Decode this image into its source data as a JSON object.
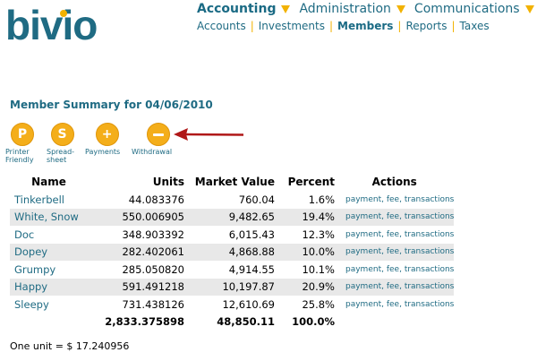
{
  "logo": {
    "text": "bivio",
    "color": "#1f6b83",
    "dot_color": "#f2b200"
  },
  "nav": {
    "top": [
      {
        "label": "Accounting",
        "active": true
      },
      {
        "label": "Administration",
        "active": false
      },
      {
        "label": "Communications",
        "active": false
      }
    ],
    "sub": [
      {
        "label": "Accounts",
        "active": false
      },
      {
        "label": "Investments",
        "active": false
      },
      {
        "label": "Members",
        "active": true
      },
      {
        "label": "Reports",
        "active": false
      },
      {
        "label": "Taxes",
        "active": false
      }
    ]
  },
  "page": {
    "title": "Member Summary for 04/06/2010"
  },
  "actions": [
    {
      "glyph": "P",
      "label_line1": "Printer",
      "label_line2": "Friendly"
    },
    {
      "glyph": "S",
      "label_line1": "Spread-",
      "label_line2": "sheet"
    },
    {
      "glyph": "+",
      "label_line1": "Payments",
      "label_line2": ""
    },
    {
      "glyph": "−",
      "label_line1": "Withdrawal",
      "label_line2": ""
    }
  ],
  "table": {
    "headers": {
      "name": "Name",
      "units": "Units",
      "market_value": "Market Value",
      "percent": "Percent",
      "actions": "Actions"
    },
    "rows": [
      {
        "name": "Tinkerbell",
        "units": "44.083376",
        "market_value": "760.04",
        "percent": "1.6%"
      },
      {
        "name": "White, Snow",
        "units": "550.006905",
        "market_value": "9,482.65",
        "percent": "19.4%"
      },
      {
        "name": "Doc",
        "units": "348.903392",
        "market_value": "6,015.43",
        "percent": "12.3%"
      },
      {
        "name": "Dopey",
        "units": "282.402061",
        "market_value": "4,868.88",
        "percent": "10.0%"
      },
      {
        "name": "Grumpy",
        "units": "285.050820",
        "market_value": "4,914.55",
        "percent": "10.1%"
      },
      {
        "name": "Happy",
        "units": "591.491218",
        "market_value": "10,197.87",
        "percent": "20.9%"
      },
      {
        "name": "Sleepy",
        "units": "731.438126",
        "market_value": "12,610.69",
        "percent": "25.8%"
      }
    ],
    "row_links": {
      "payment": "payment",
      "fee": "fee",
      "transactions": "transactions"
    },
    "totals": {
      "units": "2,833.375898",
      "market_value": "48,850.11",
      "percent": "100.0%"
    }
  },
  "footer": {
    "unit_value": "One unit = $ 17.240956"
  },
  "colors": {
    "brand": "#1f6b83",
    "accent": "#f2b200",
    "icon": "#f4ae1a",
    "stripe": "#e8e8e8",
    "arrow": "#b01818"
  }
}
